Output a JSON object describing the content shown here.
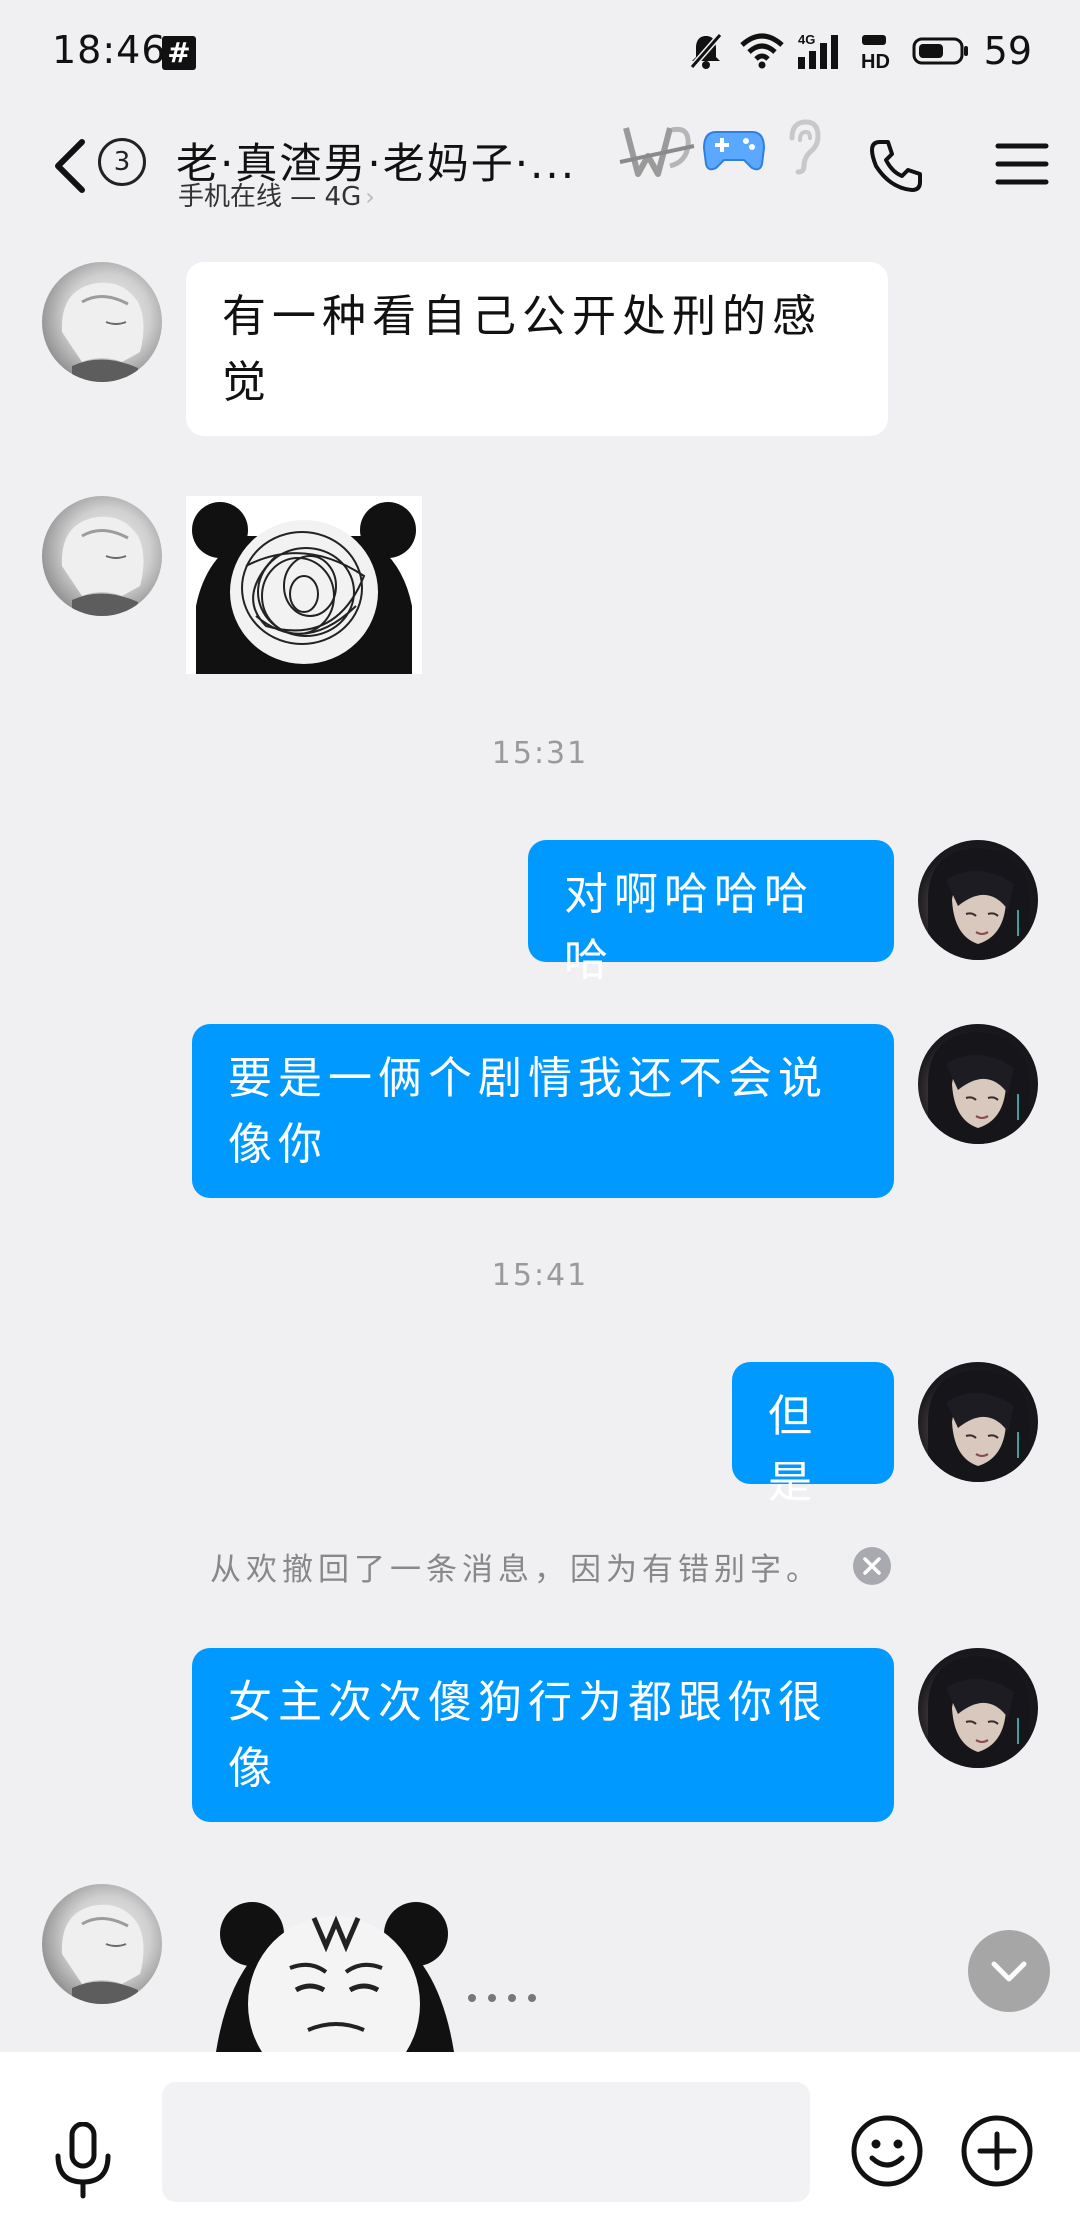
{
  "status_bar": {
    "time": "18:46",
    "battery": "59",
    "network_badge": "4G",
    "hd_label": "HD",
    "icons": [
      "hash-icon",
      "mute-icon",
      "wifi-icon",
      "signal-icon",
      "hd-icon",
      "battery-icon"
    ]
  },
  "header": {
    "unread_count": "3",
    "title": "老·真渣男·老妈子·...",
    "subtitle": "手机在线 — 4G",
    "subtitle_arrow": "›",
    "icons": [
      "back-icon",
      "level-tag-icon",
      "gamepad-icon",
      "ear-icon",
      "phone-icon",
      "menu-icon"
    ]
  },
  "messages": [
    {
      "sender": "other",
      "type": "text",
      "text": "有一种看自己公开处刑的感觉"
    },
    {
      "sender": "other",
      "type": "sticker",
      "sticker": "scribble-panda-sticker"
    },
    {
      "type": "time",
      "text": "15:31"
    },
    {
      "sender": "self",
      "type": "text",
      "text": "对啊哈哈哈哈"
    },
    {
      "sender": "self",
      "type": "text",
      "text": "要是一俩个剧情我还不会说像你"
    },
    {
      "type": "time",
      "text": "15:41"
    },
    {
      "sender": "self",
      "type": "text",
      "text": "但是"
    },
    {
      "type": "system",
      "text": "从欢撤回了一条消息，因为有错别字。"
    },
    {
      "sender": "self",
      "type": "text",
      "text": "女主次次傻狗行为都跟你很像"
    },
    {
      "sender": "other",
      "type": "sticker",
      "sticker": "angry-panda-sticker"
    }
  ],
  "input_bar": {
    "placeholder": "",
    "icons": [
      "microphone-icon",
      "emoji-icon",
      "plus-icon"
    ]
  },
  "colors": {
    "outgoing_bubble": "#0099ff",
    "incoming_bubble": "#ffffff",
    "background": "#f0f0f2"
  }
}
